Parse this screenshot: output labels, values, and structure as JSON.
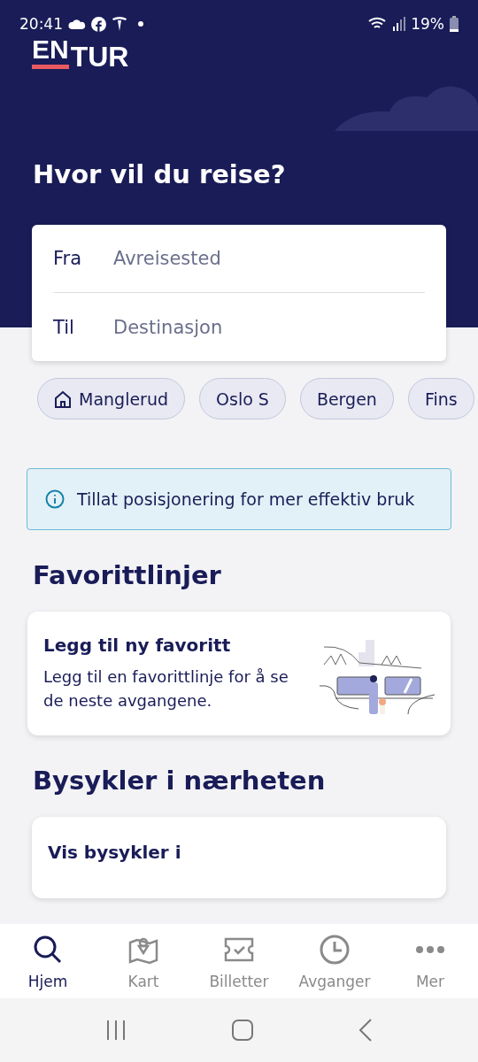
{
  "status_bar": {
    "time": "20:41",
    "battery": "19%"
  },
  "logo": {
    "part_1": "EN",
    "part_2": "TUR"
  },
  "title": "Hvor vil du reise?",
  "search": {
    "fields": [
      {
        "label": "Fra",
        "placeholder": "Avreisested"
      },
      {
        "label": "Til",
        "placeholder": "Destinasjon"
      }
    ]
  },
  "chips": [
    {
      "label": "Manglerud",
      "kind": "home"
    },
    {
      "label": "Oslo S",
      "kind": "place"
    },
    {
      "label": "Bergen",
      "kind": "place"
    },
    {
      "label": "Fins",
      "kind": "place"
    }
  ],
  "info_banner": "Tillat posisjonering for mer effektiv bruk",
  "favorites": {
    "heading": "Favorittlinjer",
    "card_title": "Legg til ny favoritt",
    "card_text": "Legg til en favorittlinje for å se de neste avgangene."
  },
  "bikes": {
    "heading": "Bysykler i nærheten",
    "card_title": "Vis bysykler i"
  },
  "bottom_nav": [
    {
      "label": "Hjem",
      "kind": "search",
      "selected": true
    },
    {
      "label": "Kart",
      "kind": "map",
      "selected": false
    },
    {
      "label": "Billetter",
      "kind": "ticket",
      "selected": false
    },
    {
      "label": "Avganger",
      "kind": "clock",
      "selected": false
    },
    {
      "label": "Mer",
      "kind": "more",
      "selected": false
    }
  ]
}
